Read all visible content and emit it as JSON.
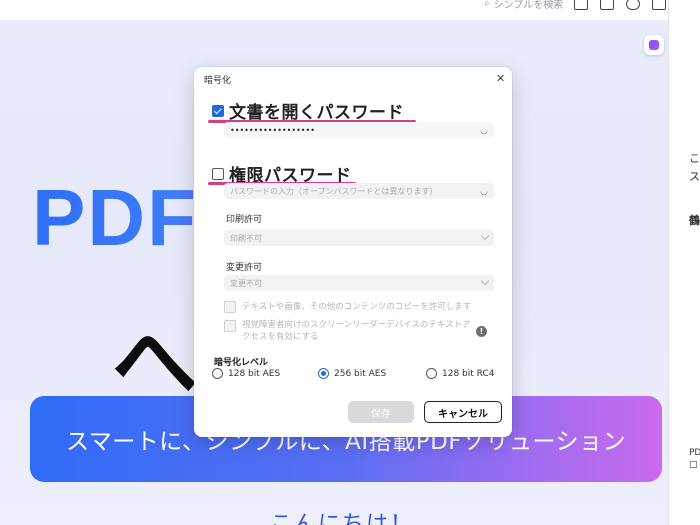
{
  "toolbar": {
    "search_placeholder": "シンプルを検索"
  },
  "welcome_page": {
    "hero_text": "PDF     at 12",
    "welcome_text": "へ   そ",
    "banner_text": "スマートに、シンプルに、AI搭載PDFソリューション",
    "greeting": "こんにちは！"
  },
  "right_panel": {
    "fragments": [
      "こ",
      "ス",
      "鶴",
      "PD",
      "□"
    ]
  },
  "dialog": {
    "title": "暗号化",
    "close_label": "✕",
    "open_password": {
      "label": "文書を開くパスワード",
      "checked": true,
      "value": "••••••••••••••••••"
    },
    "permission_password": {
      "label": "権限パスワード",
      "checked": false,
      "placeholder": "パスワードの入力（オープンパスワードとは異なります）"
    },
    "print_permission": {
      "label": "印刷許可",
      "value": "印刷不可"
    },
    "change_permission": {
      "label": "変更許可",
      "value": "変更不可"
    },
    "copy_option": "テキストや画像、その他のコンテンツのコピーを許可します",
    "screen_reader_option": "視覚障害者向けのスクリーンリーダーデバイスのテキストアクセスを有効にする",
    "encryption_level": {
      "label": "暗号化レベル",
      "options": [
        "128 bit AES",
        "256 bit AES",
        "128 bit RC4"
      ],
      "selected": "256 bit AES"
    },
    "save_button": "保存",
    "cancel_button": "キャンセル"
  },
  "colors": {
    "accent_blue": "#2469d9",
    "annotation_pink": "#d63c8a",
    "banner_start": "#2f6cf6",
    "banner_end": "#c96bec"
  }
}
